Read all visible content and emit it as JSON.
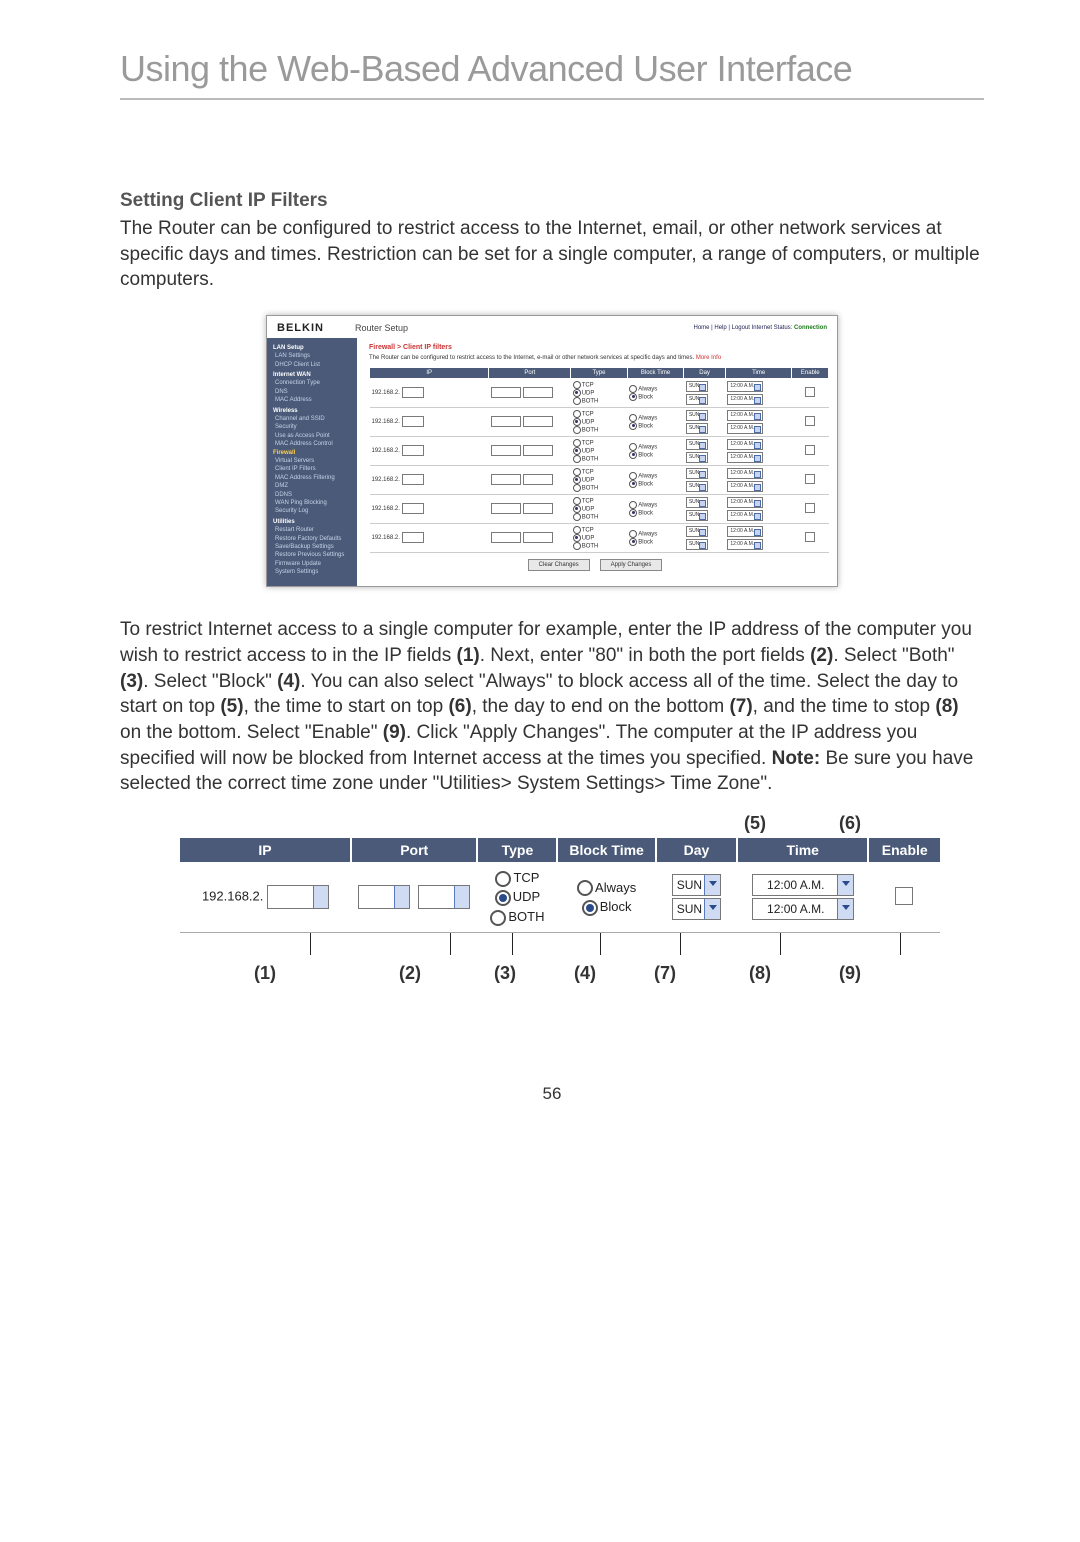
{
  "header_title": "Using the Web-Based Advanced User Interface",
  "section_title": "Setting Client IP Filters",
  "intro_para": "The Router can be configured to restrict access to the Internet, email, or other network services at specific days and times. Restriction can be set for a single computer, a range of computers, or multiple computers.",
  "body_para_pre": "To restrict Internet access to a single computer for example, enter the IP address of the computer you wish to restrict access to in the IP fields ",
  "b1": "(1)",
  "body_para_2a": ". Next, enter \"80\" in both the port fields ",
  "b2": "(2)",
  "body_para_2b": ". Select \"Both\" ",
  "b3": "(3)",
  "body_para_3a": ". Select \"Block\" ",
  "b4": "(4)",
  "body_para_3b": ". You can also select \"Always\" to block access all of the time. Select the day to start on top ",
  "b5": "(5)",
  "body_para_4a": ", the time to start on top ",
  "b6": "(6)",
  "body_para_4b": ", the day to end on the bottom ",
  "b7": "(7)",
  "body_para_4c": ", and the time to stop ",
  "b8": "(8)",
  "body_para_4d": " on the bottom. Select \"Enable\" ",
  "b9": "(9)",
  "body_para_5a": ". Click \"Apply Changes\". The computer at the IP address you specified will now be blocked from Internet access at the times you specified. ",
  "note_label": "Note:",
  "body_para_5b": " Be sure you have selected the correct time zone under \"Utilities> System Settings> Time Zone\".",
  "page_number": "56",
  "router": {
    "brand": "BELKIN",
    "title": "Router Setup",
    "toplinks_text": "Home | Help | Logout   Internet Status: ",
    "toplinks_status": "Connection",
    "breadcrumb": "Firewall > Client IP filters",
    "desc_text": "The Router can be configured to restrict access to the Internet, e-mail or other network services at specific days and times. ",
    "desc_more": "More Info",
    "sidebar": [
      {
        "t": "group",
        "label": "LAN Setup"
      },
      {
        "t": "item",
        "label": "LAN Settings"
      },
      {
        "t": "item",
        "label": "DHCP Client List"
      },
      {
        "t": "group",
        "label": "Internet WAN"
      },
      {
        "t": "item",
        "label": "Connection Type"
      },
      {
        "t": "item",
        "label": "DNS"
      },
      {
        "t": "item",
        "label": "MAC Address"
      },
      {
        "t": "group",
        "label": "Wireless"
      },
      {
        "t": "item",
        "label": "Channel and SSID"
      },
      {
        "t": "item",
        "label": "Security"
      },
      {
        "t": "item",
        "label": "Use as Access Point"
      },
      {
        "t": "item",
        "label": "MAC Address Control"
      },
      {
        "t": "active",
        "label": "Firewall"
      },
      {
        "t": "item",
        "label": "Virtual Servers"
      },
      {
        "t": "item",
        "label": "Client IP Filters"
      },
      {
        "t": "item",
        "label": "MAC Address Filtering"
      },
      {
        "t": "item",
        "label": "DMZ"
      },
      {
        "t": "item",
        "label": "DDNS"
      },
      {
        "t": "item",
        "label": "WAN Ping Blocking"
      },
      {
        "t": "item",
        "label": "Security Log"
      },
      {
        "t": "group",
        "label": "Utilities"
      },
      {
        "t": "item",
        "label": "Restart Router"
      },
      {
        "t": "item",
        "label": "Restore Factory Defaults"
      },
      {
        "t": "item",
        "label": "Save/Backup Settings"
      },
      {
        "t": "item",
        "label": "Restore Previous Settings"
      },
      {
        "t": "item",
        "label": "Firmware Update"
      },
      {
        "t": "item",
        "label": "System Settings"
      }
    ],
    "columns": {
      "ip": "IP",
      "port": "Port",
      "type": "Type",
      "block_time": "Block Time",
      "day": "Day",
      "time": "Time",
      "enable": "Enable"
    },
    "ip_prefix": "192.168.2.",
    "type_opts": {
      "tcp": "TCP",
      "udp": "UDP",
      "both": "BOTH"
    },
    "block_opts": {
      "always": "Always",
      "block": "Block"
    },
    "day_value": "SUN",
    "time_value": "12:00 A.M.",
    "row_count": 6,
    "btn_clear": "Clear Changes",
    "btn_apply": "Apply Changes"
  },
  "zoom": {
    "top5": "(5)",
    "top6": "(6)",
    "col_ip": "IP",
    "col_port": "Port",
    "col_type": "Type",
    "col_block": "Block Time",
    "col_day": "Day",
    "col_time": "Time",
    "col_enable": "Enable",
    "ip_prefix": "192.168.2.",
    "tcp": "TCP",
    "udp": "UDP",
    "both": "BOTH",
    "always": "Always",
    "block": "Block",
    "day": "SUN",
    "time": "12:00 A.M.",
    "bot1": "(1)",
    "bot2": "(2)",
    "bot3": "(3)",
    "bot4": "(4)",
    "bot7": "(7)",
    "bot8": "(8)",
    "bot9": "(9)"
  }
}
